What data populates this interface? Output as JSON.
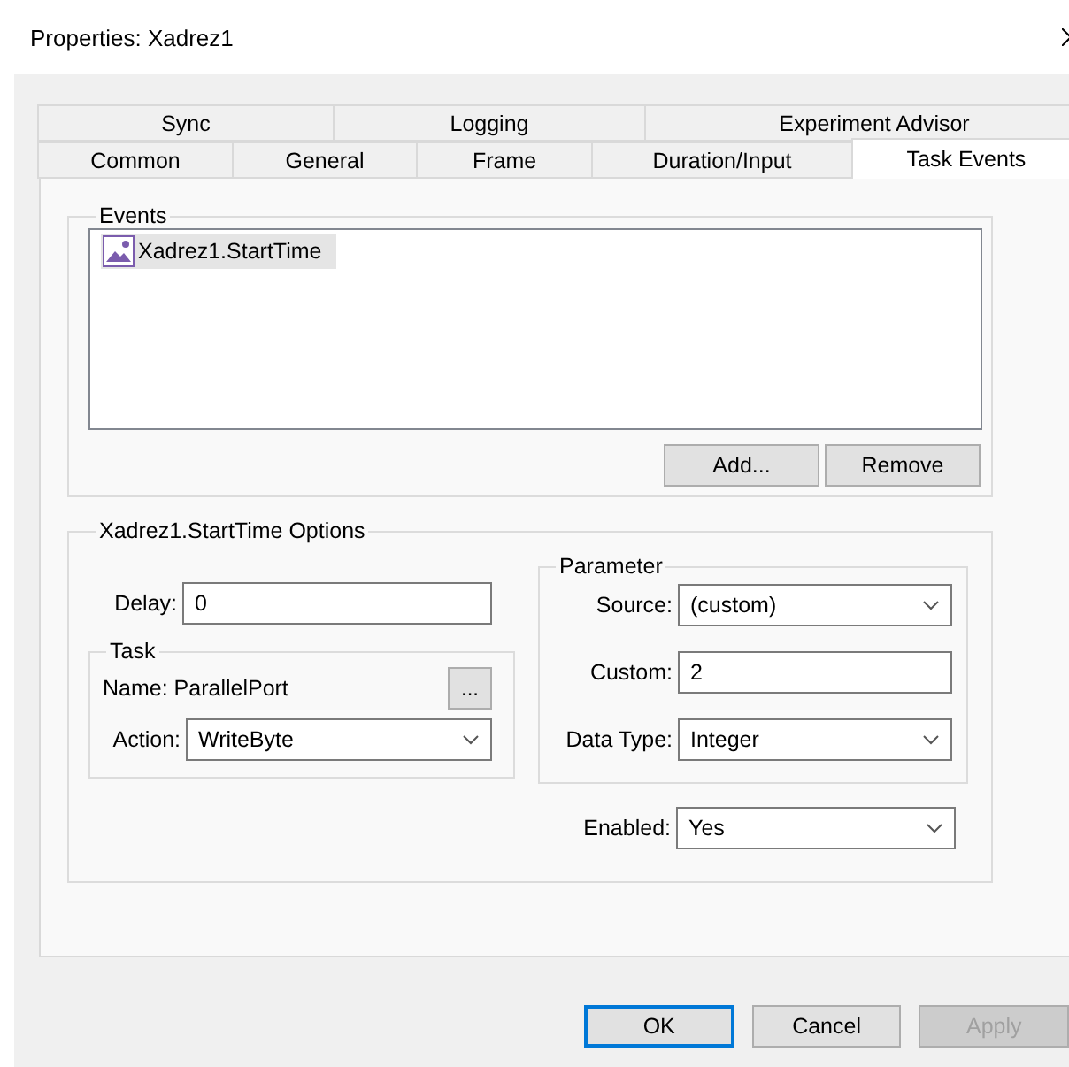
{
  "window": {
    "title": "Properties: Xadrez1"
  },
  "tab_rows": [
    [
      {
        "label": "Sync",
        "selected": false
      },
      {
        "label": "Logging",
        "selected": false
      },
      {
        "label": "Experiment Advisor",
        "selected": false
      }
    ],
    [
      {
        "label": "Common",
        "selected": false
      },
      {
        "label": "General",
        "selected": false
      },
      {
        "label": "Frame",
        "selected": false
      },
      {
        "label": "Duration/Input",
        "selected": false
      },
      {
        "label": "Task Events",
        "selected": true
      }
    ]
  ],
  "events": {
    "title": "Events",
    "items": [
      {
        "label": "Xadrez1.StartTime",
        "selected": true
      }
    ],
    "buttons": [
      "Add...",
      "Remove"
    ]
  },
  "options": {
    "title": "Xadrez1.StartTime Options",
    "delay": {
      "label": "Delay:",
      "value": "0"
    },
    "task": {
      "title": "Task",
      "name": "Name: ParallelPort",
      "browse": "...",
      "action": {
        "label": "Action:",
        "value": "WriteByte"
      }
    },
    "parameter": {
      "title": "Parameter",
      "fields": [
        {
          "kind": "select",
          "label": "Source:",
          "value": "(custom)"
        },
        {
          "kind": "text",
          "label": "Custom:",
          "value": "2"
        },
        {
          "kind": "select",
          "label": "Data Type:",
          "value": "Integer"
        }
      ]
    },
    "enabled": {
      "label": "Enabled:",
      "value": "Yes"
    }
  },
  "footer": [
    {
      "label": "OK",
      "default": true,
      "disabled": false
    },
    {
      "label": "Cancel",
      "default": false,
      "disabled": false
    },
    {
      "label": "Apply",
      "default": false,
      "disabled": true
    }
  ]
}
